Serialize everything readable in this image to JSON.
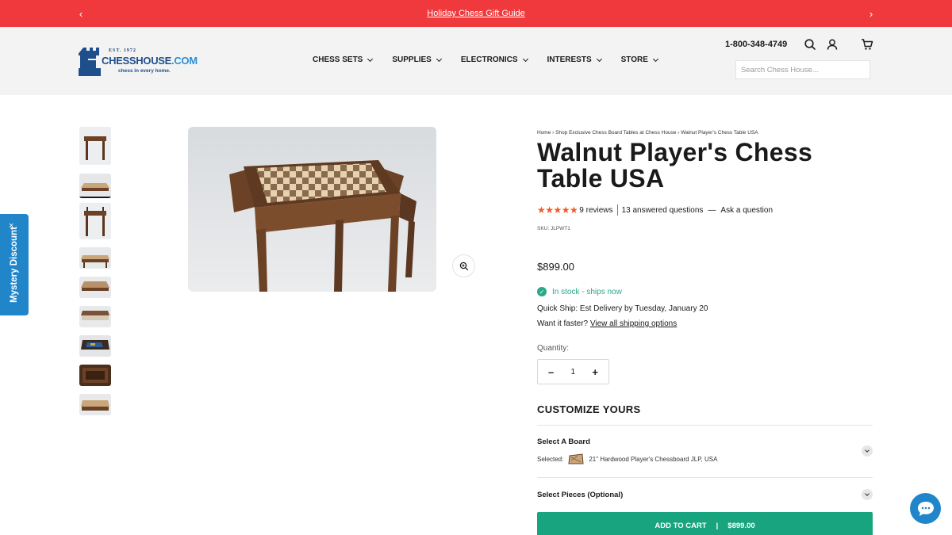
{
  "announcement": {
    "text": "Holiday Chess Gift Guide"
  },
  "header": {
    "logo": {
      "est": "EST. 1972",
      "brand": "CHESSHOUSE",
      "brand_suffix": ".COM",
      "tagline": "chess in every home."
    },
    "nav": [
      {
        "label": "CHESS SETS"
      },
      {
        "label": "SUPPLIES"
      },
      {
        "label": "ELECTRONICS"
      },
      {
        "label": "INTERESTS"
      },
      {
        "label": "STORE"
      }
    ],
    "phone": "1-800-348-4749",
    "search_placeholder": "Search Chess House...",
    "icons": [
      "search-icon",
      "account-icon",
      "cart-icon"
    ]
  },
  "side_tab": {
    "label": "Mystery Discount",
    "close": "×"
  },
  "gallery": {
    "thumbnail_count": 10,
    "active_index": 1
  },
  "product": {
    "breadcrumb": "Home › Shop Exclusive Chess Board Tables at Chess House › Walnut Player's Chess Table USA",
    "title": "Walnut Player's Chess Table USA",
    "stars": "★★★★★",
    "reviews": "9 reviews",
    "questions": "13 answered questions",
    "ask": "Ask a question",
    "sku": "SKU: JLPWT1",
    "price": "$899.00",
    "stock": "In stock - ships now",
    "quick_ship": "Quick Ship: Est Delivery by Tuesday, January 20",
    "faster_prefix": "Want it faster?",
    "faster_link": "View all shipping options",
    "quantity_label": "Quantity:",
    "quantity": "1",
    "customize_heading": "CUSTOMIZE YOURS",
    "board_option": {
      "title": "Select A Board",
      "selected_label": "Selected:",
      "selected_value": "21\" Hardwood Player's Chessboard JLP, USA"
    },
    "pieces_option": {
      "title": "Select Pieces (Optional)"
    },
    "cart_label": "ADD TO CART",
    "cart_price": "$899.00"
  },
  "colors": {
    "announce": "#f0393c",
    "accent_blue": "#2186c9",
    "cart_green": "#17a47e",
    "stock_green": "#2aa889",
    "star_orange": "#f05a28"
  }
}
